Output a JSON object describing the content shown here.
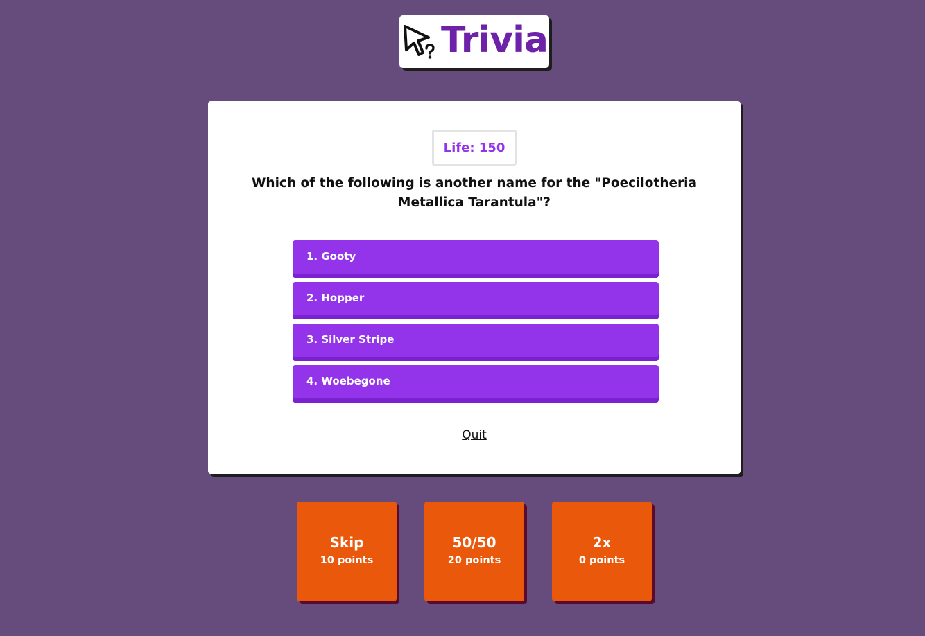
{
  "app": {
    "logo_text": "Trivia",
    "logo_icon": "cursor-question-icon",
    "colors": {
      "background": "#664c7d",
      "brand": "#6d22a8",
      "answer": "#9333ea",
      "powerup": "#ea580c"
    }
  },
  "game": {
    "life_label": "Life: 150",
    "question": "Which of the following is another name for the \"Poecilotheria Metallica Tarantula\"?",
    "answers": [
      {
        "label": "1. Gooty"
      },
      {
        "label": "2. Hopper"
      },
      {
        "label": "3. Silver Stripe"
      },
      {
        "label": "4. Woebegone"
      }
    ],
    "quit_label": "Quit"
  },
  "powerups": [
    {
      "name": "Skip",
      "cost": "10 points"
    },
    {
      "name": "50/50",
      "cost": "20 points"
    },
    {
      "name": "2x",
      "cost": "0 points"
    }
  ]
}
